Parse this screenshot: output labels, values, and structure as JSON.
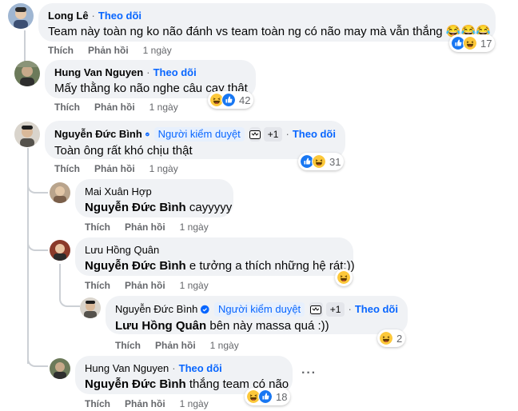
{
  "follow_label": "Theo dõi",
  "moderator_label": "Người kiểm duyệt",
  "plus_badge": "+1",
  "like_label": "Thích",
  "reply_label": "Phản hồi",
  "more_label": "···",
  "colors": {
    "link": "#0866ff",
    "bubble": "#f0f2f5",
    "muted": "#65676b"
  },
  "comments": [
    {
      "author": "Long Lê",
      "text": "Team này toàn ng ko não đánh vs team toàn ng có não may mà vẫn thắng 😂😂😂",
      "time": "1 ngày",
      "reactions": [
        "like",
        "haha"
      ],
      "count": "17"
    },
    {
      "author": "Hung Van Nguyen",
      "text": "Mấy thằng ko não nghe câu cay thật",
      "time": "1 ngày",
      "reactions": [
        "haha",
        "like"
      ],
      "count": "42"
    },
    {
      "author": "Nguyễn Đức Bình",
      "text": "Toàn ông rất khó chịu thật",
      "time": "1 ngày",
      "reactions": [
        "like",
        "haha"
      ],
      "count": "31",
      "replies": [
        {
          "author": "Mai Xuân Hợp",
          "tag": "Nguyễn Đức Bình",
          "text": "cayyyyy",
          "time": "1 ngày"
        },
        {
          "author": "Lưu Hồng Quân",
          "tag": "Nguyễn Đức Bình",
          "text": "e tưởng a thích những hệ rát:))",
          "time": "1 ngày",
          "reactions": [
            "haha"
          ]
        },
        {
          "author": "Nguyễn Đức Bình",
          "tag": "Lưu Hồng Quân",
          "text": "bên này massa quá :))",
          "time": "1 ngày",
          "reactions": [
            "haha"
          ],
          "count": "2"
        },
        {
          "author": "Hung Van Nguyen",
          "tag": "Nguyễn Đức Bình",
          "text": "thắng team có não",
          "time": "1 ngày",
          "reactions": [
            "haha",
            "like"
          ],
          "count": "18"
        }
      ]
    }
  ]
}
